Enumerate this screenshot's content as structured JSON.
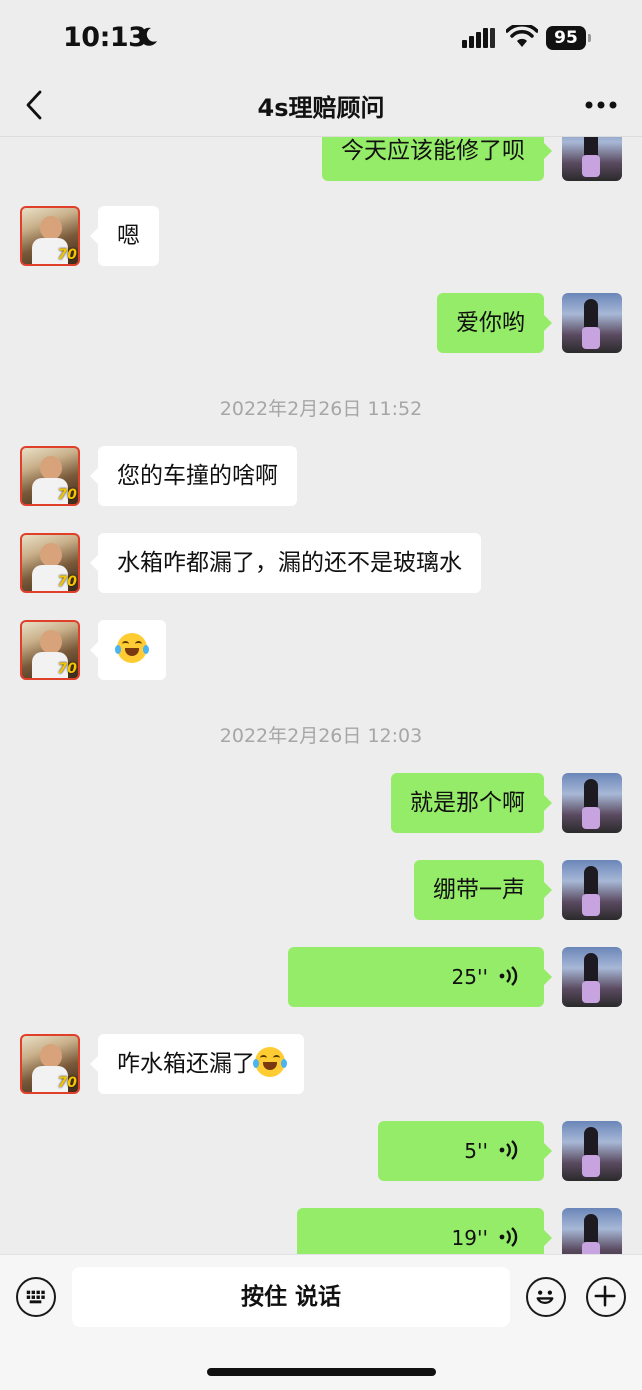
{
  "status_bar": {
    "time": "10:13",
    "battery": "95"
  },
  "nav": {
    "title": "4s理赔顾问"
  },
  "messages": [
    {
      "from": "self",
      "text": "今天应该能修了呗"
    },
    {
      "from": "other",
      "text": "嗯"
    },
    {
      "from": "self",
      "text": "爱你哟"
    },
    {
      "timestamp": "2022年2月26日 11:52"
    },
    {
      "from": "other",
      "text": "您的车撞的啥啊"
    },
    {
      "from": "other",
      "text": "水箱咋都漏了，漏的还不是玻璃水"
    },
    {
      "from": "other",
      "emoji": "joy"
    },
    {
      "timestamp": "2022年2月26日 12:03"
    },
    {
      "from": "self",
      "text": "就是那个啊"
    },
    {
      "from": "self",
      "text": "绷带一声"
    },
    {
      "from": "self",
      "voice_duration": "25''"
    },
    {
      "from": "other",
      "text": "咋水箱还漏了",
      "emoji": "joy"
    },
    {
      "from": "self",
      "voice_duration": "5''"
    },
    {
      "from": "self",
      "voice_duration": "19''"
    }
  ],
  "input_bar": {
    "talk_label": "按住 说话"
  },
  "icons": {
    "keyboard": "keyboard-icon",
    "emoji": "emoji-icon",
    "plus": "plus-icon",
    "back": "back-arrow-icon",
    "more": "more-icon",
    "joy": "face-with-tears-of-joy-icon"
  },
  "colors": {
    "self_bubble": "#95ec69",
    "other_bubble": "#ffffff",
    "background": "#ededed"
  }
}
